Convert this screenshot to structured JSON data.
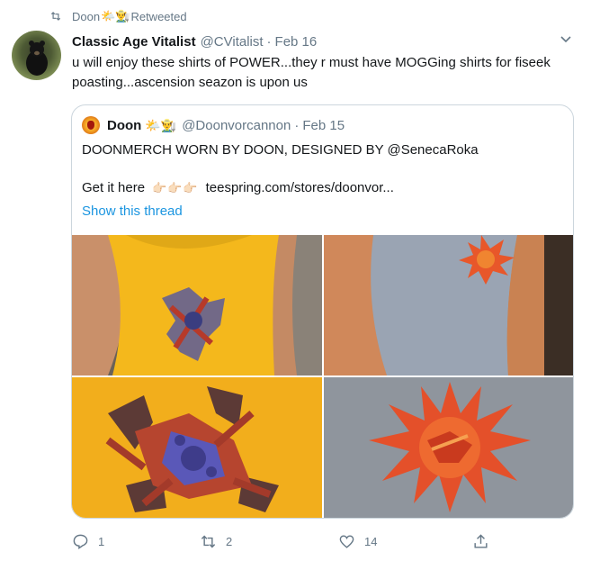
{
  "retweet_context": {
    "name": "Doon",
    "emojis": "🌤️👨‍🌾",
    "label": "Retweeted"
  },
  "tweet": {
    "author_name": "Classic Age Vitalist",
    "author_handle": "@CVitalist",
    "separator": "·",
    "date": "Feb 16",
    "text": "u will enjoy these shirts of POWER...they r must have MOGGing shirts for fiseek poasting...ascension seazon is upon us"
  },
  "quote": {
    "author_name": "Doon",
    "emojis": "🌤️👨‍🌾",
    "author_handle": "@Doonvorcannon",
    "separator": "·",
    "date": "Feb 15",
    "line1": "DOONMERCH WORN BY DOON, DESIGNED BY @SenecaRoka",
    "get_it_prefix": "Get it here",
    "hands": "👉🏻👉🏻👉🏻",
    "link_text": "teespring.com/stores/doonvor...",
    "show_thread": "Show this thread"
  },
  "actions": {
    "reply_count": "1",
    "retweet_count": "2",
    "like_count": "14"
  },
  "colors": {
    "accent": "#1b95e0",
    "secondary_text": "#657786",
    "border": "#ccd6dd"
  },
  "icons": [
    "retweet-icon",
    "caret-down-icon",
    "reply-icon",
    "retweet-icon",
    "like-icon",
    "share-icon"
  ]
}
